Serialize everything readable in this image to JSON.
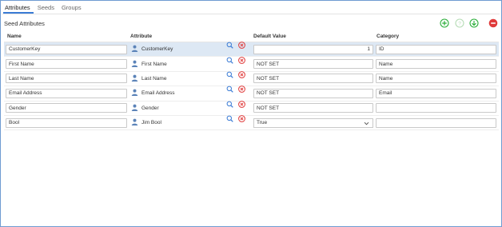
{
  "tabs": [
    {
      "label": "Attributes",
      "active": true
    },
    {
      "label": "Seeds",
      "active": false
    },
    {
      "label": "Groups",
      "active": false
    }
  ],
  "section_title": "Seed Attributes",
  "toolbar": {
    "add_icon": "add-circle-icon",
    "help_icon": "help-circle-icon",
    "download_icon": "down-arrow-circle-icon",
    "delete_icon": "minus-circle-icon"
  },
  "columns": [
    "Name",
    "Attribute",
    "Default Value",
    "Category"
  ],
  "rows": [
    {
      "name": "CustomerKey",
      "attribute": "CustomerKey",
      "default_value": "1",
      "default_type": "number",
      "category": "ID",
      "selected": true
    },
    {
      "name": "First Name",
      "attribute": "First Name",
      "default_value": "NOT SET",
      "default_type": "text",
      "category": "Name",
      "selected": false
    },
    {
      "name": "Last Name",
      "attribute": "Last Name",
      "default_value": "NOT SET",
      "default_type": "text",
      "category": "Name",
      "selected": false
    },
    {
      "name": "Email Address",
      "attribute": "Email Address",
      "default_value": "NOT SET",
      "default_type": "text",
      "category": "Email",
      "selected": false
    },
    {
      "name": "Gender",
      "attribute": "Gender",
      "default_value": "NOT SET",
      "default_type": "text",
      "category": "",
      "selected": false
    },
    {
      "name": "Bool",
      "attribute": "Jim Bool",
      "default_value": "True",
      "default_type": "select",
      "category": "",
      "selected": false
    }
  ],
  "colors": {
    "accent": "#3a7bd5",
    "add_green": "#2bae3a",
    "help_green": "#b6dcb6",
    "remove_red": "#e03a3a",
    "selected_row": "#dde8f4",
    "person_blue": "#5b83b8"
  }
}
